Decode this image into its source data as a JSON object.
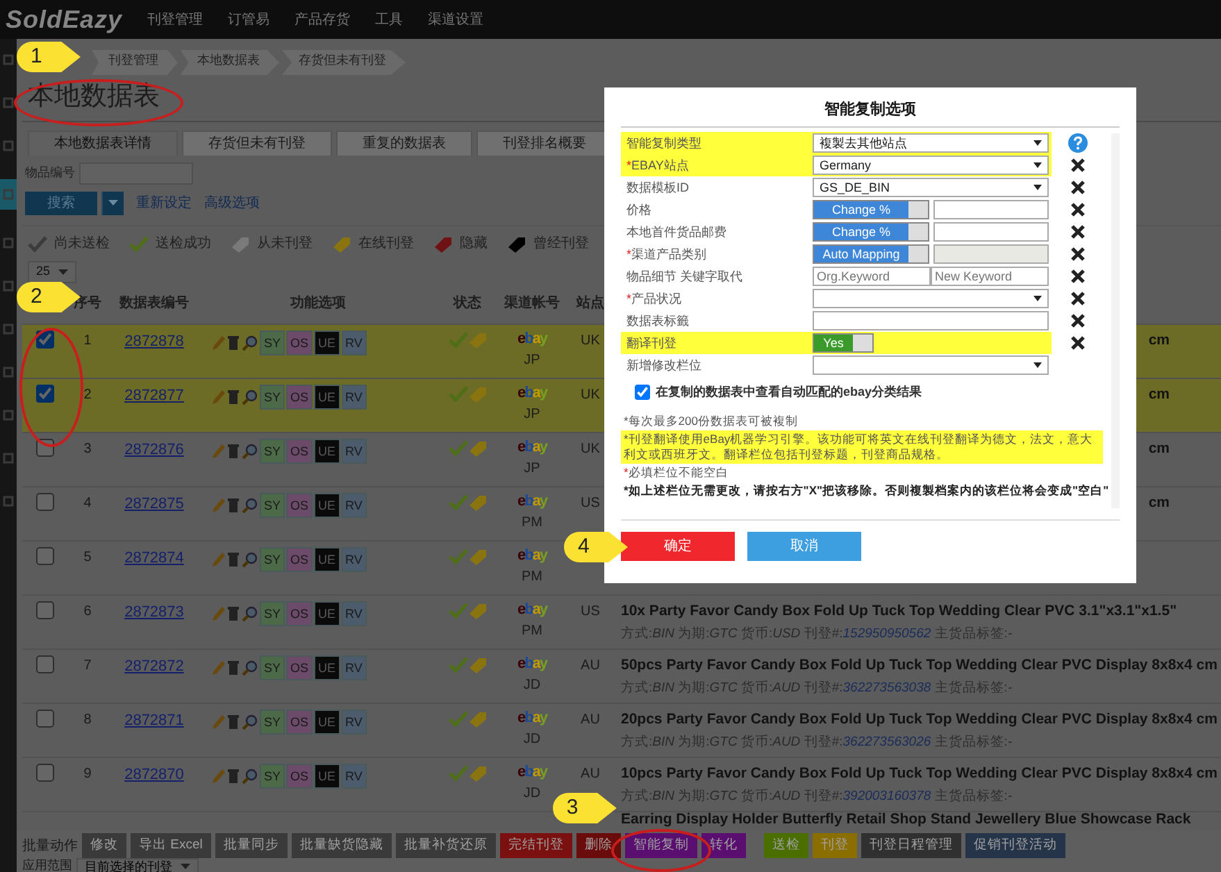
{
  "navbar": {
    "logo": "SoldEazy",
    "menu": [
      "刊登管理",
      "订管易",
      "产品存货",
      "工具",
      "渠道设置"
    ]
  },
  "sidebar": {
    "items": [
      {
        "selected": false
      },
      {
        "selected": false
      },
      {
        "selected": false
      },
      {
        "selected": true
      },
      {
        "selected": false
      },
      {
        "selected": false
      },
      {
        "selected": false
      },
      {
        "selected": false
      },
      {
        "selected": false
      },
      {
        "selected": false
      },
      {
        "selected": false
      }
    ]
  },
  "breadcrumb": [
    "刊登管理",
    "本地数据表",
    "存货但未有刊登"
  ],
  "page_title": "本地数据表",
  "tabs": [
    {
      "label": "本地数据表详情",
      "selected": true
    },
    {
      "label": "存货但未有刊登",
      "selected": false
    },
    {
      "label": "重复的数据表",
      "selected": false
    },
    {
      "label": "刊登排名概要",
      "selected": false
    }
  ],
  "search_form": {
    "label": "物品编号",
    "search_button": "搜索",
    "reset_link": "重新设定",
    "advanced_link": "高级选项"
  },
  "legend": [
    {
      "kind": "check",
      "color": "#3c3c3c",
      "label": "尚未送检"
    },
    {
      "kind": "check",
      "color": "#4e6e18",
      "label": "送检成功"
    },
    {
      "kind": "tag",
      "color": "#7a7a7a",
      "label": "从未刊登"
    },
    {
      "kind": "tag",
      "color": "#8a7410",
      "label": "在线刊登"
    },
    {
      "kind": "tag",
      "color": "#6e1216",
      "label": "隐藏"
    },
    {
      "kind": "tag",
      "color": "#000000",
      "label": "曾经刊登"
    }
  ],
  "page_size": "25",
  "table": {
    "columns": [
      "序号",
      "数据表编号",
      "功能选项",
      "状态",
      "渠道帐号",
      "站点"
    ],
    "rows": [
      {
        "selected": true,
        "number": "1",
        "id": "2872878",
        "tags": [
          "SY",
          "OS",
          "UE",
          "RV"
        ],
        "channel": "ebay",
        "account": "JP",
        "site": "UK",
        "title_end": "cm"
      },
      {
        "selected": true,
        "number": "2",
        "id": "2872877",
        "tags": [
          "SY",
          "OS",
          "UE",
          "RV"
        ],
        "channel": "ebay",
        "account": "JP",
        "site": "UK",
        "title_end": "cm"
      },
      {
        "selected": false,
        "number": "3",
        "id": "2872876",
        "tags": [
          "SY",
          "OS",
          "UE",
          "RV"
        ],
        "channel": "ebay",
        "account": "JP",
        "site": "UK",
        "title_end": "cm"
      },
      {
        "selected": false,
        "number": "4",
        "id": "2872875",
        "tags": [
          "SY",
          "OS",
          "UE",
          "RV"
        ],
        "channel": "ebay",
        "account": "PM",
        "site": "US",
        "title_end": "cm"
      },
      {
        "selected": false,
        "number": "5",
        "id": "2872874",
        "tags": [
          "SY",
          "OS",
          "UE",
          "RV"
        ],
        "channel": "ebay",
        "account": "PM"
      },
      {
        "selected": false,
        "number": "6",
        "id": "2872873",
        "tags": [
          "SY",
          "OS",
          "UE",
          "RV"
        ],
        "channel": "ebay",
        "account": "PM",
        "site": "US",
        "title": "10x Party Favor Candy Box Fold Up Tuck Top Wedding Clear PVC 3.1\"x3.1\"x1.5\"",
        "meta": [
          {
            "label": "方式:",
            "value": "BIN"
          },
          {
            "label": "为期:",
            "value": "GTC"
          },
          {
            "label": "货币:",
            "value": "USD"
          },
          {
            "label": "刊登#:",
            "value": "152950950562",
            "kind": "link"
          },
          {
            "label": "主货品标签:",
            "value": "-"
          }
        ]
      },
      {
        "selected": false,
        "number": "7",
        "id": "2872872",
        "tags": [
          "SY",
          "OS",
          "UE",
          "RV"
        ],
        "channel": "ebay",
        "account": "JD",
        "site": "AU",
        "title": "50pcs Party Favor Candy Box Fold Up Tuck Top Wedding Clear PVC Display 8x8x4 cm",
        "meta": [
          {
            "label": "方式:",
            "value": "BIN"
          },
          {
            "label": "为期:",
            "value": "GTC"
          },
          {
            "label": "货币:",
            "value": "AUD"
          },
          {
            "label": "刊登#:",
            "value": "362273563038",
            "kind": "link"
          },
          {
            "label": "主货品标签:",
            "value": "-"
          }
        ]
      },
      {
        "selected": false,
        "number": "8",
        "id": "2872871",
        "tags": [
          "SY",
          "OS",
          "UE",
          "RV"
        ],
        "channel": "ebay",
        "account": "JD",
        "site": "AU",
        "title": "20pcs Party Favor Candy Box Fold Up Tuck Top Wedding Clear PVC Display 8x8x4 cm",
        "meta": [
          {
            "label": "方式:",
            "value": "BIN"
          },
          {
            "label": "为期:",
            "value": "GTC"
          },
          {
            "label": "货币:",
            "value": "AUD"
          },
          {
            "label": "刊登#:",
            "value": "362273563026",
            "kind": "link"
          },
          {
            "label": "主货品标签:",
            "value": "-"
          }
        ]
      },
      {
        "selected": false,
        "number": "9",
        "id": "2872870",
        "tags": [
          "SY",
          "OS",
          "UE",
          "RV"
        ],
        "channel": "ebay",
        "account": "JD",
        "site": "AU",
        "title": "10pcs Party Favor Candy Box Fold Up Tuck Top Wedding Clear PVC Display 8x8x4 cm",
        "meta": [
          {
            "label": "方式:",
            "value": "BIN"
          },
          {
            "label": "为期:",
            "value": "GTC"
          },
          {
            "label": "货币:",
            "value": "AUD"
          },
          {
            "label": "刊登#:",
            "value": "392003160378",
            "kind": "link"
          },
          {
            "label": "主货品标签:",
            "value": "-"
          }
        ]
      },
      {
        "selected": false,
        "title": "Earring Display Holder Butterfly Retail Shop Stand Jewellery Blue Showcase Rack"
      }
    ]
  },
  "bulk_actions": {
    "label": "批量动作",
    "groups": [
      [
        {
          "label": "修改",
          "color": "#3a3a3a"
        },
        {
          "label": "导出 Excel",
          "color": "#3a3a3a"
        },
        {
          "label": "批量同步",
          "color": "#3a3a3a"
        },
        {
          "label": "批量缺货隐藏",
          "color": "#3a3a3a"
        },
        {
          "label": "批量补货还原",
          "color": "#3a3a3a"
        },
        {
          "label": "完结刊登",
          "color": "#7a1010"
        },
        {
          "label": "删除",
          "color": "#6a0c0c"
        },
        {
          "label": "智能复制",
          "color": "#5a0f70"
        },
        {
          "label": "转化",
          "color": "#5a0f70"
        }
      ],
      [
        {
          "label": "送检",
          "color": "#4a6e00"
        },
        {
          "label": "刊登",
          "color": "#8a6e00"
        },
        {
          "label": "刊登日程管理",
          "color": "#303030"
        },
        {
          "label": "促销刊登活动",
          "color": "#26344a"
        }
      ]
    ]
  },
  "scope": {
    "label": "应用范围",
    "value": "目前选择的刊登"
  },
  "modal": {
    "title": "智能复制选项",
    "fields": [
      {
        "label": "智能复制类型",
        "kind": "select",
        "value": "複製去其他站点",
        "highlight": true,
        "help": true,
        "removable": false
      },
      {
        "mark": "*",
        "label": "EBAY站点",
        "kind": "select",
        "value": "Germany",
        "highlight": true,
        "removable": true
      },
      {
        "label": "数据模板ID",
        "kind": "select",
        "value": "GS_DE_BIN",
        "highlight": false,
        "removable": true
      },
      {
        "label": "价格",
        "kind": "toggle-input",
        "toggle": "Change %",
        "on": true,
        "disabled": false,
        "highlight": false,
        "removable": true
      },
      {
        "label": "本地首件货品邮费",
        "kind": "toggle-input",
        "toggle": "Change %",
        "on": true,
        "disabled": false,
        "highlight": false,
        "removable": true
      },
      {
        "mark": "*",
        "label": "渠道产品类别",
        "kind": "toggle-input",
        "toggle": "Auto Mapping",
        "on": true,
        "disabled": true,
        "highlight": false,
        "removable": true
      },
      {
        "label": "物品细节 关键字取代",
        "kind": "keywords",
        "placeholders": [
          "Org.Keyword",
          "New Keyword"
        ],
        "highlight": false,
        "removable": true
      },
      {
        "mark": "*",
        "label": "产品状况",
        "kind": "select",
        "highlight": false,
        "removable": true
      },
      {
        "label": "数据表标籤",
        "kind": "input",
        "highlight": false,
        "removable": true
      },
      {
        "label": "翻译刊登",
        "kind": "toggle",
        "toggle": "Yes",
        "on": true,
        "highlight": true,
        "removable": true
      },
      {
        "label": "新增修改栏位",
        "kind": "select",
        "highlight": false,
        "removable": false
      }
    ],
    "checkbox": {
      "label": "在复制的数据表中查看自动匹配的ebay分类结果",
      "checked": true
    },
    "notes": [
      {
        "text": "*每次最多200份数据表可被複制",
        "kind": "plain"
      },
      {
        "text": "*刊登翻译使用eBay机器学习引擎。该功能可将英文在线刊登翻译为德文，法文，意大利文或西班牙文。翻译栏位包括刊登标题，刊登商品规格。",
        "kind": "highlight"
      },
      {
        "mark": "*",
        "text": "必填栏位不能空白",
        "kind": "required"
      },
      {
        "text": "*如上述栏位无需更改，请按右方\"X\"把该移除。否则複製档案内的该栏位将会变成\"空白\"",
        "kind": "bold"
      }
    ],
    "buttons": [
      {
        "label": "确定",
        "kind": "confirm"
      },
      {
        "label": "取消",
        "kind": "cancel"
      }
    ]
  },
  "callouts": [
    "1",
    "2",
    "3",
    "4"
  ]
}
